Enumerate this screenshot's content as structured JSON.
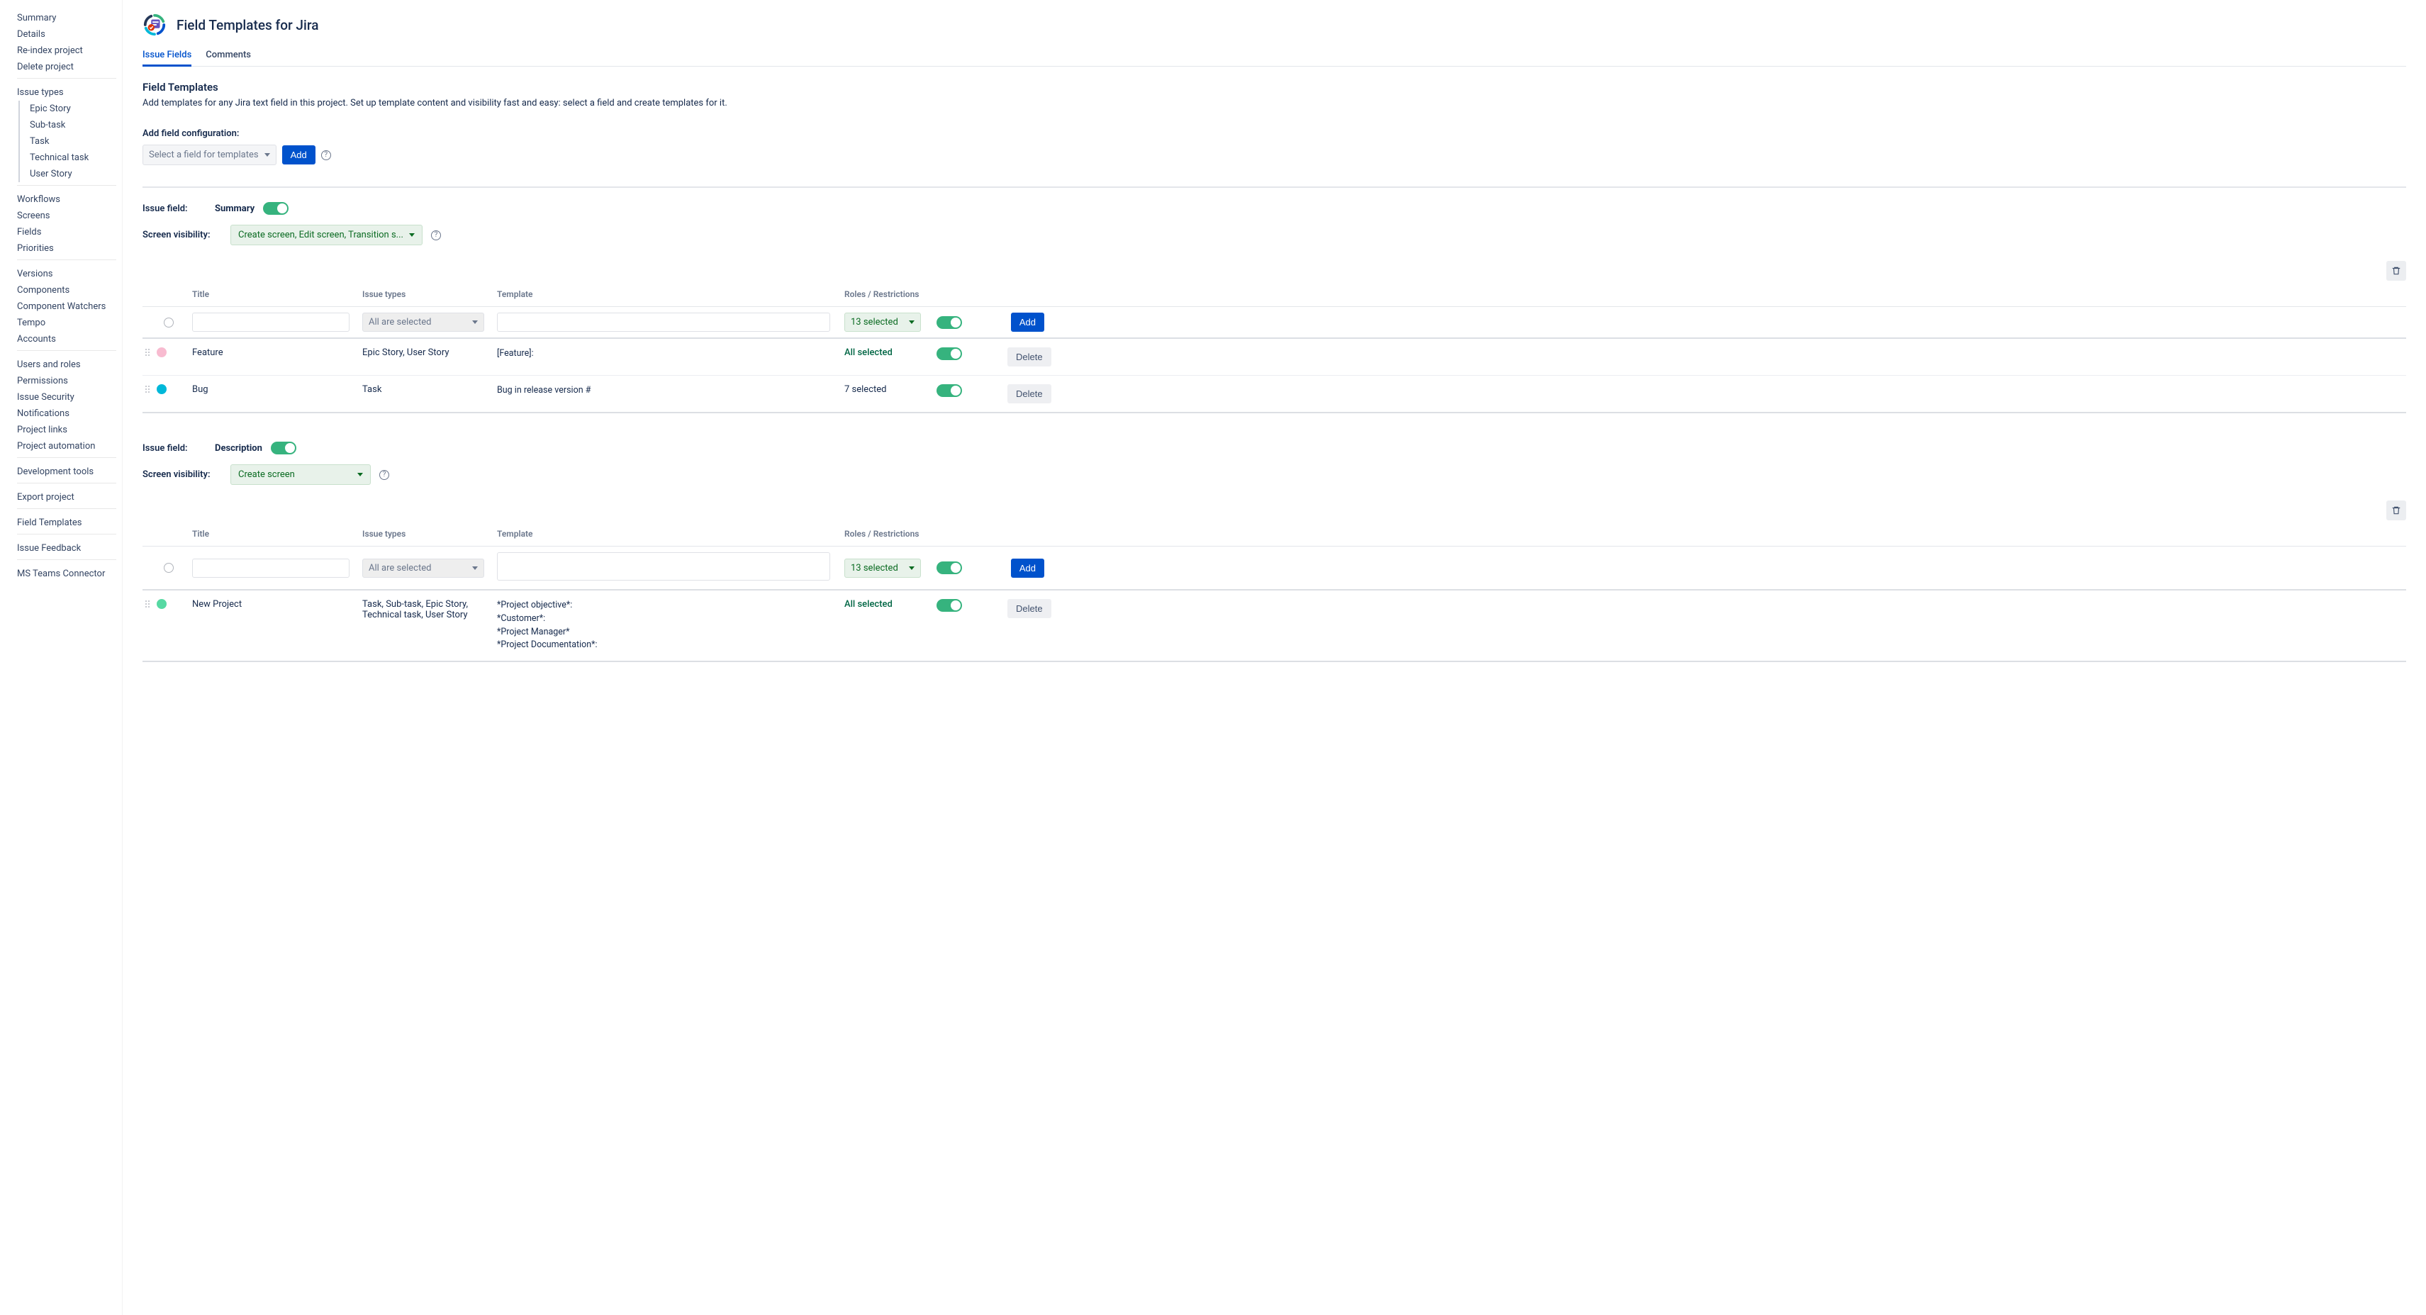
{
  "app": {
    "title": "Field Templates for Jira"
  },
  "sidebar": {
    "g0": [
      "Summary",
      "Details",
      "Re-index project",
      "Delete project"
    ],
    "issue_types_label": "Issue types",
    "issue_types": [
      "Epic Story",
      "Sub-task",
      "Task",
      "Technical task",
      "User Story"
    ],
    "g2": [
      "Workflows",
      "Screens",
      "Fields",
      "Priorities"
    ],
    "g3": [
      "Versions",
      "Components",
      "Component Watchers",
      "Tempo",
      "Accounts"
    ],
    "g4": [
      "Users and roles",
      "Permissions",
      "Issue Security",
      "Notifications",
      "Project links",
      "Project automation"
    ],
    "g5": [
      "Development tools"
    ],
    "g6": [
      "Export project"
    ],
    "g7": [
      "Field Templates"
    ],
    "g8": [
      "Issue Feedback"
    ],
    "g9": [
      "MS Teams Connector"
    ]
  },
  "tabs": {
    "t0": "Issue Fields",
    "t1": "Comments"
  },
  "section": {
    "title": "Field Templates",
    "desc": "Add templates for any Jira text field in this project. Set up template content and visibility fast and easy: select a field and create templates for it."
  },
  "cfg": {
    "label": "Add field configuration:",
    "select_placeholder": "Select a field for templates",
    "add_btn": "Add"
  },
  "cols": {
    "title": "Title",
    "issue_types": "Issue types",
    "template": "Template",
    "roles": "Roles / Restrictions"
  },
  "addrow": {
    "issue_types": "All are selected",
    "roles": "13 selected",
    "btn": "Add"
  },
  "btns": {
    "delete": "Delete"
  },
  "labels": {
    "issue_field": "Issue field:",
    "screen_vis": "Screen visibility:"
  },
  "fs1": {
    "name": "Summary",
    "screen": "Create screen, Edit screen, Transition s...",
    "rows": [
      {
        "title": "Feature",
        "types": "Epic Story, User Story",
        "tmpl": "[Feature]:",
        "roles": "All selected",
        "roles_all": true,
        "dot": "pink"
      },
      {
        "title": "Bug",
        "types": "Task",
        "tmpl": "Bug in release version #",
        "roles": "7 selected",
        "roles_all": false,
        "dot": "teal"
      }
    ]
  },
  "fs2": {
    "name": "Description",
    "screen": "Create screen",
    "rows": [
      {
        "title": "New Project",
        "types": "Task, Sub-task, Epic Story, Technical task, User Story",
        "tmpl": "*Project objective*:\n*Customer*:\n*Project Manager*\n*Project Documentation*:",
        "roles": "All selected",
        "roles_all": true,
        "dot": "green"
      }
    ]
  }
}
